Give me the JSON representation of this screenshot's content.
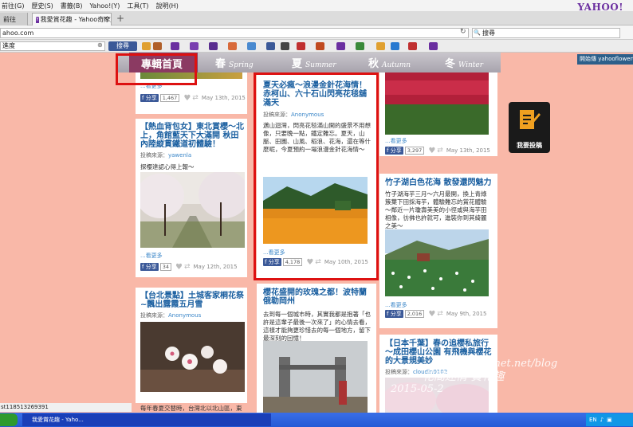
{
  "browser": {
    "menu": [
      "前往",
      "歷史",
      "書籤",
      "Yahoo!",
      "工具",
      "說明"
    ],
    "menu_keys": [
      "(G)",
      "(S)",
      "(B)",
      "(Y)",
      "(T)",
      "(H)"
    ],
    "brand": "YAHOO!",
    "tabs": [
      {
        "label": "前往"
      },
      {
        "label": "我愛賞花趣 - Yahoo奇摩旅遊"
      }
    ],
    "new_tab": "+",
    "url": "ahoo.com",
    "search_placeholder": "搜尋",
    "toolbar_input": "進度",
    "toolbar_search": "搜尋"
  },
  "nav": {
    "home": "專輯首頁",
    "spring": {
      "zh": "春",
      "en": "Spring"
    },
    "summer": {
      "zh": "夏",
      "en": "Summer"
    },
    "autumn": {
      "zh": "秋",
      "en": "Autumn"
    },
    "winter": {
      "zh": "冬",
      "en": "Winter"
    }
  },
  "right_panel": {
    "label": "開始傳 yahooflowertrip"
  },
  "submit_button": {
    "label": "我要投稿"
  },
  "cards": {
    "c1_top": {
      "more": "...看更多",
      "fb": "分享",
      "count": "1,467",
      "date": "May 13th, 2015"
    },
    "c1": {
      "title": "【熱血背包女】東北賞櫻～北上，角館藍天下大滿開 秋田內陸縱貫鐵道初體驗！",
      "source_label": "投稿來源：",
      "source": "yawenla",
      "body": "探櫻達認心得上報～",
      "more": "...看更多",
      "fb": "分享",
      "count": "34",
      "date": "May 12th, 2015"
    },
    "c2": {
      "title": "【台北景點】土城客家桐花祭~飄出露霞五月雪",
      "source_label": "投稿來源：",
      "source": "Anonymous",
      "body": "每年春夏交替時，台灣北以北山區，東部區"
    },
    "c3": {
      "title": "夏天必瘋～浪漫金針花海情！赤柯山、六十石山閃亮花毯舖滿天",
      "source_label": "投稿來源：",
      "source": "Anonymous",
      "body": "邁山迴灣，閃亮花毯滿山開的盛景不用想像，只要晚一點，鐵定難忘。夏天，山脈、田園、山風、稻浪、花海，還在等什麼呢，今夏預約一場浪漫金針花海情～",
      "more": "...看更多",
      "fb": "分享",
      "count": "4,178",
      "date": "May 10th, 2015"
    },
    "c4": {
      "title": "櫻花盛開的玫瑰之都！波特蘭俄勒岡州",
      "source_label": "",
      "source": "",
      "body": "去到每一個城市時，其實我都是抱著「也許是這輩子最後一次來了」的心情去看，這樣才能夠更珍惜去的每一個地方，留下最深刻的回憶！"
    },
    "c5_top": {
      "more": "...看更多",
      "fb": "分享",
      "count": "3,297",
      "date": "May 13th, 2015"
    },
    "c5": {
      "title": "竹子湖白色花海 散發還閃魅力",
      "source_label": "",
      "source": "",
      "body": "竹子湖海芋三月～六月最開，換上青綠簇葉下田採海芋，體驗難忘的賞花體驗～鄰近一片瓊壽美美的小徑或與海芋田相像，彷佛也許就可，進裝你到其綺麗之美～",
      "more": "...看更多",
      "fb": "分享",
      "count": "2,016",
      "date": "May 9th, 2015"
    },
    "c6": {
      "title": "【日本千葉】春の追櫻私旅行～成田櫻山公園 有飛機與櫻花的大景規美妙",
      "source_label": "投稿來源：",
      "source": "cloudin0102"
    }
  },
  "watermark": {
    "line1": "ixnet.net/blog",
    "line2": "花間迷情",
    "line3": "2015-05-2",
    "line4": "賞花趣"
  },
  "status": {
    "text": "st118513269391"
  },
  "taskbar": {
    "active": "我愛賞花趣 - Yaho...",
    "tray": "EN"
  }
}
